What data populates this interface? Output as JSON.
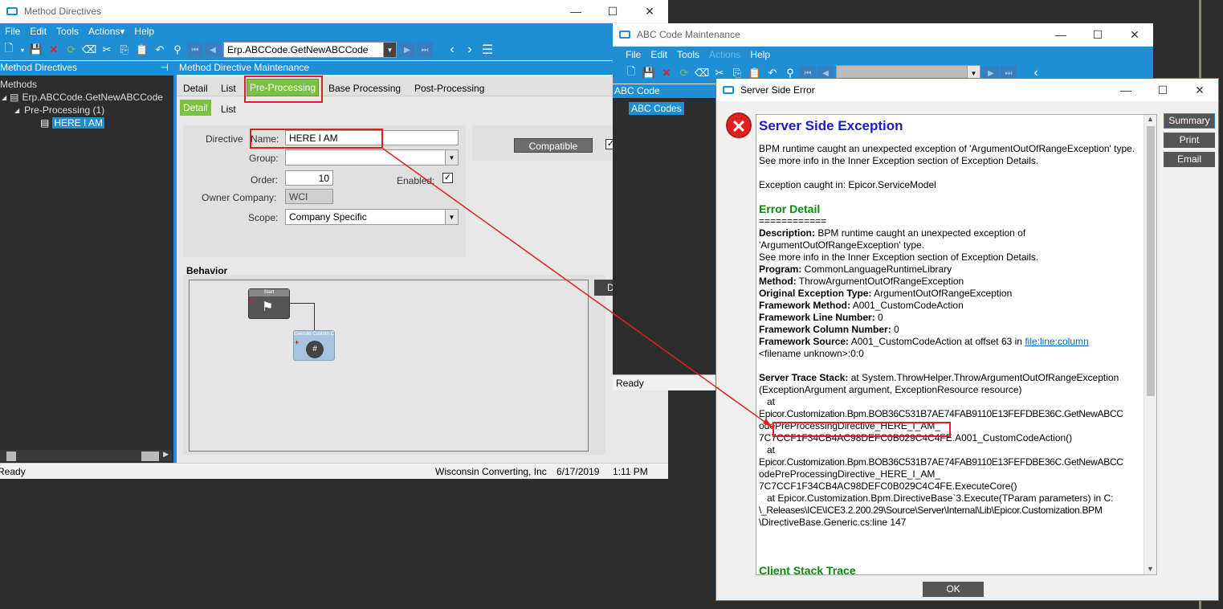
{
  "method_window": {
    "title": "Method Directives",
    "menu": [
      "File",
      "Edit",
      "Tools",
      "Actions▾",
      "Help"
    ],
    "nav_combo": "Erp.ABCCode.GetNewABCCode",
    "tree_header": "Method Directives",
    "tree": {
      "root": "Methods",
      "method": "Erp.ABCCode.GetNewABCCode",
      "group": "Pre-Processing (1)",
      "item": "HERE I AM"
    },
    "panel_header": "Method Directive Maintenance",
    "tabs": [
      "Detail",
      "List",
      "Pre-Processing",
      "Base Processing",
      "Post-Processing"
    ],
    "subtabs": [
      "Detail",
      "List"
    ],
    "form": {
      "directive_label": "Directive",
      "name_label": "Name:",
      "name_value": "HERE I AM",
      "group_label": "Group:",
      "order_label": "Order:",
      "order_value": "10",
      "enabled_label": "Enabled:",
      "owner_label": "Owner Company:",
      "owner_value": "WCI",
      "scope_label": "Scope:",
      "scope_value": "Company Specific",
      "compatible_button": "Compatible"
    },
    "behavior_label": "Behavior",
    "nodes": {
      "start": "Start",
      "exec": "Execute Custom C..."
    },
    "side_button": "D",
    "status": {
      "text": "Ready",
      "company": "Wisconsin Converting, Inc",
      "date": "6/17/2019",
      "time": "1:11 PM"
    }
  },
  "abc_window": {
    "title": "ABC Code Maintenance",
    "menu": [
      "File",
      "Edit",
      "Tools",
      "Actions",
      "Help"
    ],
    "left_header": "ABC Code",
    "left_tab": "ABC Codes",
    "status": "Ready"
  },
  "error_window": {
    "title": "Server Side Error",
    "heading": "Server Side Exception",
    "intro": [
      "BPM runtime caught an unexpected exception of 'ArgumentOutOfRangeException' type.",
      "See more info in the Inner Exception section of Exception Details."
    ],
    "caught_in": "Exception caught in: Epicor.ServiceModel",
    "detail_heading": "Error Detail",
    "separator": "============",
    "fields": [
      {
        "label": "Description:",
        "value": " BPM runtime caught an unexpected exception of"
      },
      {
        "label": "",
        "value": "'ArgumentOutOfRangeException' type."
      },
      {
        "label": "",
        "value": "See more info in the Inner Exception section of Exception Details."
      },
      {
        "label": "Program:",
        "value": " CommonLanguageRuntimeLibrary"
      },
      {
        "label": "Method:",
        "value": " ThrowArgumentOutOfRangeException"
      },
      {
        "label": "Original Exception Type:",
        "value": " ArgumentOutOfRangeException"
      },
      {
        "label": "Framework Method:",
        "value": " A001_CustomCodeAction"
      },
      {
        "label": "Framework Line Number:",
        "value": " 0"
      },
      {
        "label": "Framework Column Number:",
        "value": " 0"
      }
    ],
    "source_label": "Framework Source:",
    "source_value": " A001_CustomCodeAction at offset 63 in ",
    "source_link": "file:line:column",
    "source_tail": "<filename unknown>:0:0",
    "trace_label": "Server Trace Stack:",
    "trace_lines": [
      "     at System.ThrowHelper.ThrowArgumentOutOfRangeException",
      "(ExceptionArgument argument, ExceptionResource resource)",
      "   at",
      "Epicor.Customization.Bpm.BOB36C531B7AE74FAB9110E13FEFDBE36C.GetNewABCC",
      "odePreProcessingDirective_HERE_I_AM_",
      "7C7CCF1F34CB4AC98DEFC0B029C4C4FE.A001_CustomCodeAction()",
      "   at",
      "Epicor.Customization.Bpm.BOB36C531B7AE74FAB9110E13FEFDBE36C.GetNewABCC",
      "odePreProcessingDirective_HERE_I_AM_",
      "7C7CCF1F34CB4AC98DEFC0B029C4C4FE.ExecuteCore()",
      "   at Epicor.Customization.Bpm.DirectiveBase`3.Execute(TParam parameters) in C:",
      "\\_Releases\\ICE\\ICE3.2.200.29\\Source\\Server\\Internal\\Lib\\Epicor.Customization.BPM",
      "\\DirectiveBase.Generic.cs:line 147"
    ],
    "client_heading": "Client Stack Trace",
    "buttons": [
      "Summary",
      "Print",
      "Email"
    ],
    "ok": "OK"
  },
  "colors": {
    "accent": "#1e8fd5",
    "highlight_tab": "#7ac143",
    "annotation": "#e02020",
    "link": "#0563c1",
    "heading_blue": "#1c1ccf",
    "heading_green": "#0a8a0a"
  }
}
